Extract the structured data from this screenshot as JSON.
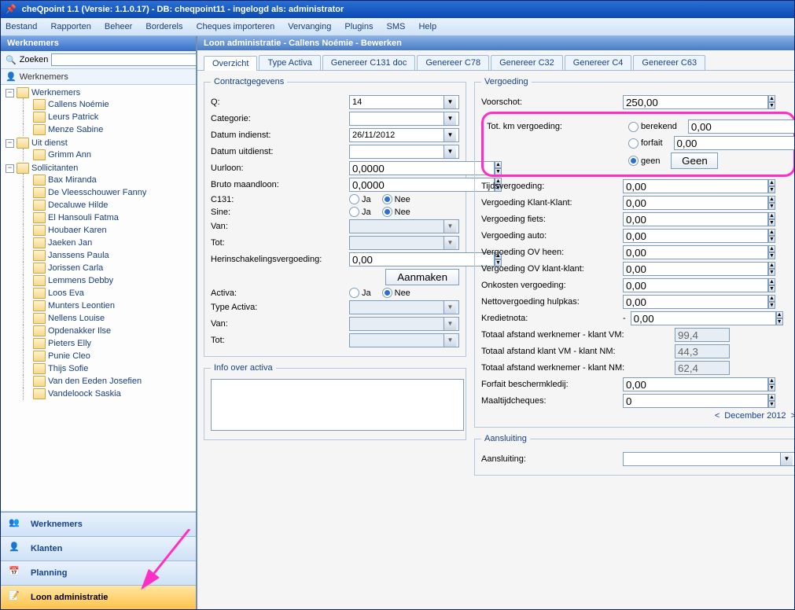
{
  "title": "cheQpoint 1.1 (Versie: 1.1.0.17) - DB: cheqpoint11 - ingelogd als: administrator",
  "menu": [
    "Bestand",
    "Rapporten",
    "Beheer",
    "Borderels",
    "Cheques importeren",
    "Vervanging",
    "Plugins",
    "SMS",
    "Help"
  ],
  "left": {
    "header": "Werknemers",
    "search_label": "Zoeken",
    "list_label": "Werknemers",
    "tree": {
      "werknemers": {
        "label": "Werknemers",
        "items": [
          "Callens  Noémie",
          "Leurs Patrick",
          "Menze Sabine"
        ]
      },
      "uitdienst": {
        "label": "Uit dienst",
        "items": [
          "Grimm Ann"
        ]
      },
      "sollicitanten": {
        "label": "Sollicitanten",
        "items": [
          "Bax Miranda",
          "De Vleesschouwer Fanny",
          "Decaluwe Hilde",
          "El Hansouli Fatma",
          "Houbaer Karen",
          "Jaeken Jan",
          "Janssens Paula",
          "Jorissen Carla",
          "Lemmens Debby",
          "Loos Eva",
          "Munters Leontien",
          "Nellens Louise",
          "Opdenakker Ilse",
          "Pieters Elly",
          "Punie Cleo",
          "Thijs Sofie",
          "Van den Eeden Josefien",
          "Vandeloock Saskia"
        ]
      }
    },
    "nav": [
      "Werknemers",
      "Klanten",
      "Planning",
      "Loon administratie"
    ],
    "nav_active": 3
  },
  "main": {
    "header": "Loon administratie - Callens  Noémie - Bewerken",
    "tabs": [
      "Overzicht",
      "Type Activa",
      "Genereer C131 doc",
      "Genereer C78",
      "Genereer C32",
      "Genereer C4",
      "Genereer C63"
    ],
    "active_tab": 0,
    "contract": {
      "legend": "Contractgegevens",
      "q_label": "Q:",
      "q_val": "14",
      "cat_label": "Categorie:",
      "cat_val": "",
      "in_label": "Datum indienst:",
      "in_val": "26/11/2012",
      "out_label": "Datum uitdienst:",
      "out_val": "",
      "uur_label": "Uurloon:",
      "uur_val": "0,0000",
      "bruto_label": "Bruto maandloon:",
      "bruto_val": "0,0000",
      "c131_label": "C131:",
      "ja": "Ja",
      "nee": "Nee",
      "sine_label": "Sine:",
      "van_label": "Van:",
      "tot_label": "Tot:",
      "herin_label": "Herinschakelingsvergoeding:",
      "herin_val": "0,00",
      "aanmaken": "Aanmaken",
      "activa_label": "Activa:",
      "type_activa_label": "Type Activa:",
      "van2_label": "Van:",
      "tot2_label": "Tot:"
    },
    "info": {
      "legend": "Info over activa"
    },
    "verg": {
      "legend": "Vergoeding",
      "voorschot_label": "Voorschot:",
      "voorschot_val": "250,00",
      "totkm_label": "Tot. km vergoeding:",
      "berekend": "berekend",
      "forfait": "forfait",
      "geen": "geen",
      "geen_btn": "Geen",
      "zero": "0,00",
      "tv": "Tijdsvergoeding:",
      "vkk": "Vergoeding Klant-Klant:",
      "vf": "Vergoeding fiets:",
      "va": "Vergoeding auto:",
      "voh": "Vergoeding OV heen:",
      "vokk": "Vergoeding OV klant-klant:",
      "onk": "Onkosten vergoeding:",
      "net": "Nettovergoeding hulpkas:",
      "kred": "Kredietnota:",
      "dash": "-",
      "taf_vm": "Totaal afstand werknemer - klant VM:",
      "taf_vm_v": "99,4",
      "taf_kk": "Totaal afstand klant VM - klant NM:",
      "taf_kk_v": "44,3",
      "taf_nm": "Totaal afstand werknemer - klant NM:",
      "taf_nm_v": "62,4",
      "forf": "Forfait beschermkledij:",
      "maalt": "Maaltijdcheques:",
      "maalt_v": "0",
      "month": "December 2012"
    },
    "aans": {
      "legend": "Aansluiting",
      "label": "Aansluiting:"
    }
  }
}
